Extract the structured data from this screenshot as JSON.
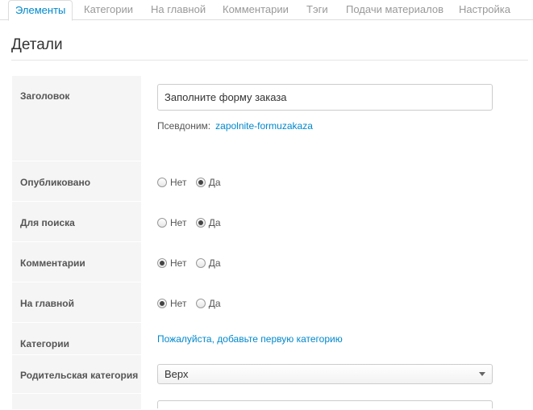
{
  "tabs": [
    {
      "label": "Элементы",
      "active": true
    },
    {
      "label": "Категории",
      "active": false
    },
    {
      "label": "На главной",
      "active": false
    },
    {
      "label": "Комментарии",
      "active": false
    },
    {
      "label": "Тэги",
      "active": false
    },
    {
      "label": "Подачи материалов",
      "active": false
    },
    {
      "label": "Настройка",
      "active": false
    }
  ],
  "page": {
    "title": "Детали"
  },
  "form": {
    "title_field": {
      "label": "Заголовок",
      "value": "Заполните форму заказа"
    },
    "alias": {
      "label": "Псевдоним:",
      "value": "zapolnite-formuzakaza"
    },
    "published": {
      "label": "Опубликовано",
      "options": [
        "Нет",
        "Да"
      ],
      "selected": "Да"
    },
    "searchable": {
      "label": "Для поиска",
      "options": [
        "Нет",
        "Да"
      ],
      "selected": "Да"
    },
    "comments": {
      "label": "Комментарии",
      "options": [
        "Нет",
        "Да"
      ],
      "selected": "Нет"
    },
    "frontpage": {
      "label": "На главной",
      "options": [
        "Нет",
        "Да"
      ],
      "selected": "Нет"
    },
    "categories": {
      "label": "Категории",
      "link_text": "Пожалуйста, добавьте первую категорию"
    },
    "parent_category": {
      "label": "Родительская категория",
      "selected": "Верх"
    }
  },
  "colors": {
    "accent": "#0088cc",
    "label_bg": "#f5f5f5",
    "muted_text": "#999999"
  }
}
